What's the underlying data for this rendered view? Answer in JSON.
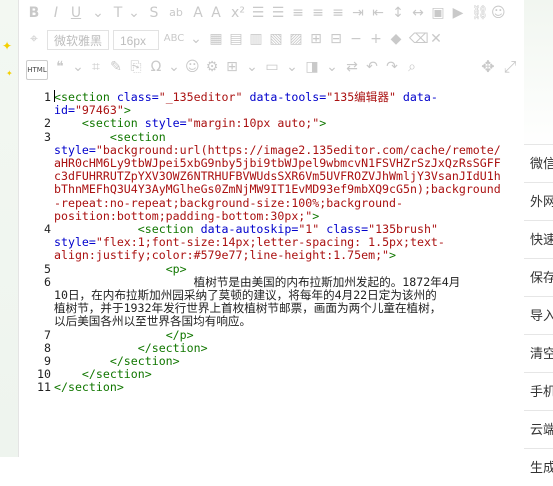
{
  "toolbar": {
    "font_family": "微软雅黑",
    "font_size": "16px",
    "html_label": "HTML"
  },
  "code": {
    "line_numbers": [
      "1",
      "2",
      "3",
      "4",
      "5",
      "6",
      "7",
      "8",
      "9",
      "10",
      "11"
    ],
    "lines": [
      {
        "n": "1",
        "segs": [
          {
            "c": "tag",
            "t": "<section"
          },
          {
            "c": "attr",
            "t": " class="
          },
          {
            "c": "str",
            "t": "\"_135editor\""
          },
          {
            "c": "attr",
            "t": " data-tools="
          },
          {
            "c": "str",
            "t": "\"135编辑器\""
          },
          {
            "c": "attr",
            "t": " data-"
          }
        ]
      },
      {
        "n": "",
        "segs": [
          {
            "c": "attr",
            "t": "id="
          },
          {
            "c": "str",
            "t": "\"97463\""
          },
          {
            "c": "tag",
            "t": ">"
          }
        ]
      },
      {
        "n": "2",
        "segs": [
          {
            "c": "txt",
            "t": "    "
          },
          {
            "c": "tag",
            "t": "<section"
          },
          {
            "c": "attr",
            "t": " style="
          },
          {
            "c": "str",
            "t": "\"margin:10px auto;\""
          },
          {
            "c": "tag",
            "t": ">"
          }
        ]
      },
      {
        "n": "3",
        "segs": [
          {
            "c": "txt",
            "t": "        "
          },
          {
            "c": "tag",
            "t": "<section"
          }
        ]
      },
      {
        "n": "",
        "segs": [
          {
            "c": "attr",
            "t": "style="
          },
          {
            "c": "str",
            "t": "\"background:url(https://image2.135editor.com/cache/remote/"
          }
        ]
      },
      {
        "n": "",
        "segs": [
          {
            "c": "str",
            "t": "aHR0cHM6Ly9tbWJpei5xbG9nby5jbi9tbWJpel9wbmcvN1FSVHZrSzJxQzRsSGFF"
          }
        ]
      },
      {
        "n": "",
        "segs": [
          {
            "c": "str",
            "t": "c3dFUHRRUTZpYXV3OWZ6NTRHUFBVWUdsSXR6Vm5UVFROZVJhWmljY3VsanJIdU1h"
          }
        ]
      },
      {
        "n": "",
        "segs": [
          {
            "c": "str",
            "t": "bThnMEFhQ3U4Y3AyMGlheGs0ZmNjMW9IT1EvMD93ef9mbXQ9cG5n);background"
          }
        ]
      },
      {
        "n": "",
        "segs": [
          {
            "c": "str",
            "t": "-repeat:no-repeat;background-size:100%;background-"
          }
        ]
      },
      {
        "n": "",
        "segs": [
          {
            "c": "str",
            "t": "position:bottom;padding-bottom:30px;\""
          },
          {
            "c": "tag",
            "t": ">"
          }
        ]
      },
      {
        "n": "4",
        "segs": [
          {
            "c": "txt",
            "t": "            "
          },
          {
            "c": "tag",
            "t": "<section"
          },
          {
            "c": "attr",
            "t": " data-autoskip="
          },
          {
            "c": "str",
            "t": "\"1\""
          },
          {
            "c": "attr",
            "t": " class="
          },
          {
            "c": "str",
            "t": "\"135brush\""
          }
        ]
      },
      {
        "n": "",
        "segs": [
          {
            "c": "attr",
            "t": "style="
          },
          {
            "c": "str",
            "t": "\"flex:1;font-size:14px;letter-spacing: 1.5px;text-"
          }
        ]
      },
      {
        "n": "",
        "segs": [
          {
            "c": "str",
            "t": "align:justify;color:#579e77;line-height:1.75em;\""
          },
          {
            "c": "tag",
            "t": ">"
          }
        ]
      },
      {
        "n": "5",
        "segs": [
          {
            "c": "txt",
            "t": "                "
          },
          {
            "c": "tag",
            "t": "<p>"
          }
        ]
      },
      {
        "n": "6",
        "segs": [
          {
            "c": "txt",
            "t": "                    植树节是由美国的内布拉斯加州发起的。1872年4月"
          }
        ]
      },
      {
        "n": "",
        "segs": [
          {
            "c": "txt",
            "t": "10日，在内布拉斯加州园采纳了莫顿的建议，将每年的4月22日定为该州的"
          }
        ]
      },
      {
        "n": "",
        "segs": [
          {
            "c": "txt",
            "t": "植树节，并于1932年发行世界上首枚植树节邮票，画面为两个儿童在植树，"
          }
        ]
      },
      {
        "n": "",
        "segs": [
          {
            "c": "txt",
            "t": "以后美国各州以至世界各国均有响应。"
          }
        ]
      },
      {
        "n": "7",
        "segs": [
          {
            "c": "txt",
            "t": "                "
          },
          {
            "c": "tag",
            "t": "</p>"
          }
        ]
      },
      {
        "n": "8",
        "segs": [
          {
            "c": "txt",
            "t": "            "
          },
          {
            "c": "tag",
            "t": "</section>"
          }
        ]
      },
      {
        "n": "9",
        "segs": [
          {
            "c": "txt",
            "t": "        "
          },
          {
            "c": "tag",
            "t": "</section>"
          }
        ]
      },
      {
        "n": "10",
        "segs": [
          {
            "c": "txt",
            "t": "    "
          },
          {
            "c": "tag",
            "t": "</section>"
          }
        ]
      },
      {
        "n": "11",
        "segs": [
          {
            "c": "tag",
            "t": "</section>"
          }
        ]
      }
    ]
  },
  "sidebar": {
    "items": [
      "微信",
      "外网",
      "快速",
      "保存",
      "导入",
      "清空",
      "手机",
      "云端",
      "生成"
    ]
  }
}
